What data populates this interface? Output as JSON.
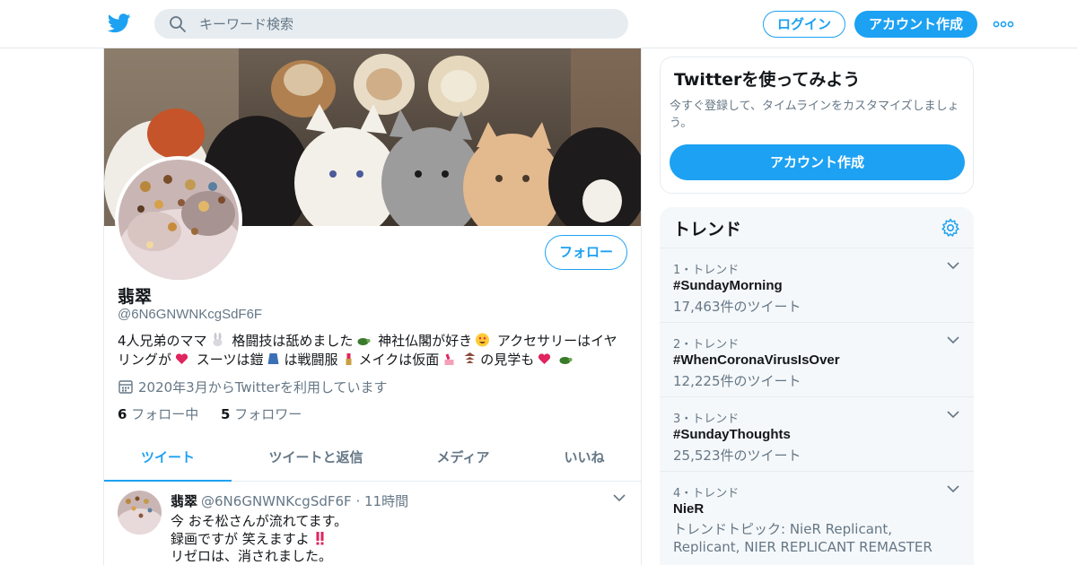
{
  "header": {
    "search_placeholder": "キーワード検索",
    "login_label": "ログイン",
    "signup_label": "アカウント作成",
    "brand_color": "#1da1f2"
  },
  "profile": {
    "name": "翡翠",
    "handle": "@6N6GNWNKcgSdF6F",
    "follow_label": "フォロー",
    "bio_parts": [
      "4人兄弟のママ",
      " 格闘技は舐めました",
      " 神社仏閣が好き",
      " アクセサリーはイヤリングが",
      " スーツは鎧",
      "は戦闘服",
      "メイクは仮面",
      "の見学も"
    ],
    "joined": "2020年3月からTwitterを利用しています",
    "following_count": "6",
    "following_label": "フォロー中",
    "followers_count": "5",
    "followers_label": "フォロワー"
  },
  "tabs": [
    "ツイート",
    "ツイートと返信",
    "メディア",
    "いいね"
  ],
  "tweet": {
    "name": "翡翠",
    "handle": "@6N6GNWNKcgSdF6F",
    "time": "· 11時間",
    "lines": [
      "今 おそ松さんが流れてます。",
      "録画ですが 笑えますよ",
      "リゼロは、消されました。"
    ]
  },
  "signup_card": {
    "title": "Twitterを使ってみよう",
    "text": "今すぐ登録して、タイムラインをカスタマイズしましょう。",
    "button": "アカウント作成"
  },
  "trends": {
    "title": "トレンド",
    "items": [
      {
        "meta": "1・トレンド",
        "name": "#SundayMorning",
        "count": "17,463件のツイート"
      },
      {
        "meta": "2・トレンド",
        "name": "#WhenCoronaVirusIsOver",
        "count": "12,225件のツイート"
      },
      {
        "meta": "3・トレンド",
        "name": "#SundayThoughts",
        "count": "25,523件のツイート"
      },
      {
        "meta": "4・トレンド",
        "name": "NieR",
        "count": "トレンドトピック: NieR Replicant, Replicant, NIER REPLICANT REMASTER"
      }
    ]
  },
  "icons": [
    "twitter-bird-icon",
    "search-icon",
    "more-icon",
    "calendar-icon",
    "chevron-down-icon",
    "gear-icon"
  ]
}
